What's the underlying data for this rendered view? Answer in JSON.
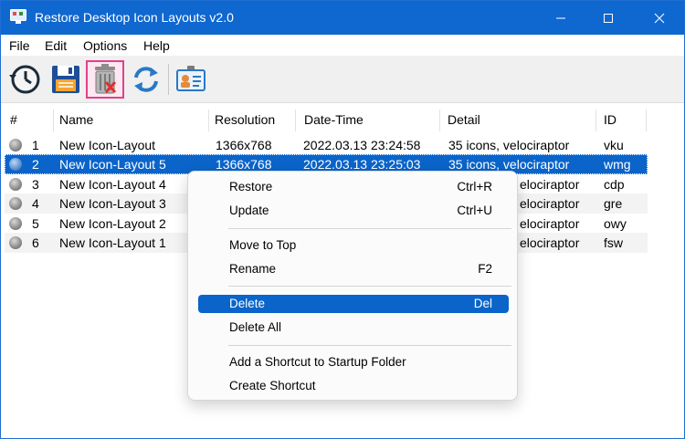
{
  "window": {
    "title": "Restore Desktop Icon Layouts v2.0"
  },
  "menubar": {
    "items": [
      {
        "label": "File"
      },
      {
        "label": "Edit"
      },
      {
        "label": "Options"
      },
      {
        "label": "Help"
      }
    ]
  },
  "toolbar": {
    "buttons": [
      {
        "icon": "restore-clock-icon"
      },
      {
        "icon": "save-floppy-icon"
      },
      {
        "icon": "delete-trash-icon",
        "active": true
      },
      {
        "icon": "refresh-icon"
      },
      {
        "icon": "id-card-icon"
      }
    ]
  },
  "table": {
    "columns": [
      "#",
      "Name",
      "Resolution",
      "Date-Time",
      "Detail",
      "ID"
    ],
    "rows": [
      {
        "num": "1",
        "name": "New Icon-Layout",
        "resolution": "1366x768",
        "datetime": "2022.03.13 23:24:58",
        "detail": "35 icons, velociraptor",
        "id": "vku"
      },
      {
        "num": "2",
        "name": "New Icon-Layout 5",
        "resolution": "1366x768",
        "datetime": "2022.03.13 23:25:03",
        "detail": "35 icons, velociraptor",
        "id": "wmg"
      },
      {
        "num": "3",
        "name": "New Icon-Layout 4",
        "resolution": "",
        "datetime": "",
        "detail": "elociraptor",
        "id": "cdp"
      },
      {
        "num": "4",
        "name": "New Icon-Layout 3",
        "resolution": "",
        "datetime": "",
        "detail": "elociraptor",
        "id": "gre"
      },
      {
        "num": "5",
        "name": "New Icon-Layout 2",
        "resolution": "",
        "datetime": "",
        "detail": "elociraptor",
        "id": "owy"
      },
      {
        "num": "6",
        "name": "New Icon-Layout 1",
        "resolution": "",
        "datetime": "",
        "detail": "elociraptor",
        "id": "fsw"
      }
    ]
  },
  "context_menu": {
    "items": [
      {
        "label": "Restore",
        "shortcut": "Ctrl+R"
      },
      {
        "label": "Update",
        "shortcut": "Ctrl+U"
      },
      {
        "label": "Move to Top",
        "shortcut": ""
      },
      {
        "label": "Rename",
        "shortcut": "F2"
      },
      {
        "label": "Delete",
        "shortcut": "Del"
      },
      {
        "label": "Delete All",
        "shortcut": ""
      },
      {
        "label": "Add a Shortcut to Startup Folder",
        "shortcut": ""
      },
      {
        "label": "Create Shortcut",
        "shortcut": ""
      }
    ]
  },
  "colors": {
    "titlebar": "#0f67d0",
    "selection": "#0a64c9",
    "toolbar_active_border": "#e0418a"
  }
}
